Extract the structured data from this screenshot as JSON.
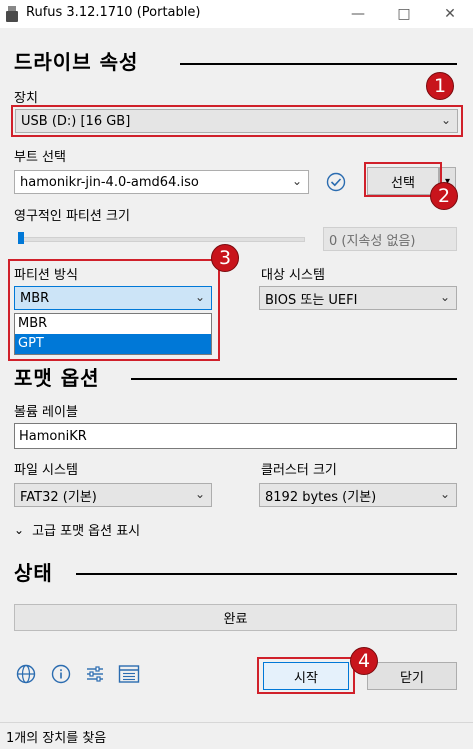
{
  "window": {
    "title": "Rufus 3.12.1710 (Portable)",
    "minimize": "—",
    "maximize": "□",
    "close": "✕"
  },
  "drive": {
    "heading": "드라이브 속성",
    "device_label": "장치",
    "device_value": "USB (D:) [16 GB]",
    "boot_label": "부트 선택",
    "boot_value": "hamonikr-jin-4.0-amd64.iso",
    "select_button": "선택",
    "persistent_label": "영구적인 파티션 크기",
    "persistent_value": "0 (지속성 없음)",
    "partition_label": "파티션 방식",
    "partition_value": "MBR",
    "partition_options": [
      "MBR",
      "GPT"
    ],
    "target_label": "대상 시스템",
    "target_value": "BIOS 또는 UEFI"
  },
  "format": {
    "heading": "포맷 옵션",
    "volume_label": "볼륨 레이블",
    "volume_value": "HamoniKR",
    "fs_label": "파일 시스템",
    "fs_value": "FAT32 (기본)",
    "cluster_label": "클러스터 크기",
    "cluster_value": "8192 bytes (기본)",
    "advanced_toggle": "고급 포맷 옵션 표시"
  },
  "status": {
    "heading": "상태",
    "progress_text": "완료",
    "progress_fraction": 0
  },
  "actions": {
    "start": "시작",
    "close": "닫기"
  },
  "statusbar": {
    "text": "1개의 장치를 찾음"
  },
  "annotations": {
    "n1": "1",
    "n2": "2",
    "n3": "3",
    "n4": "4"
  },
  "colors": {
    "annotation_red": "#d0202a",
    "selection_blue": "#0078d7",
    "dropdown_bg": "#cce4f7"
  }
}
